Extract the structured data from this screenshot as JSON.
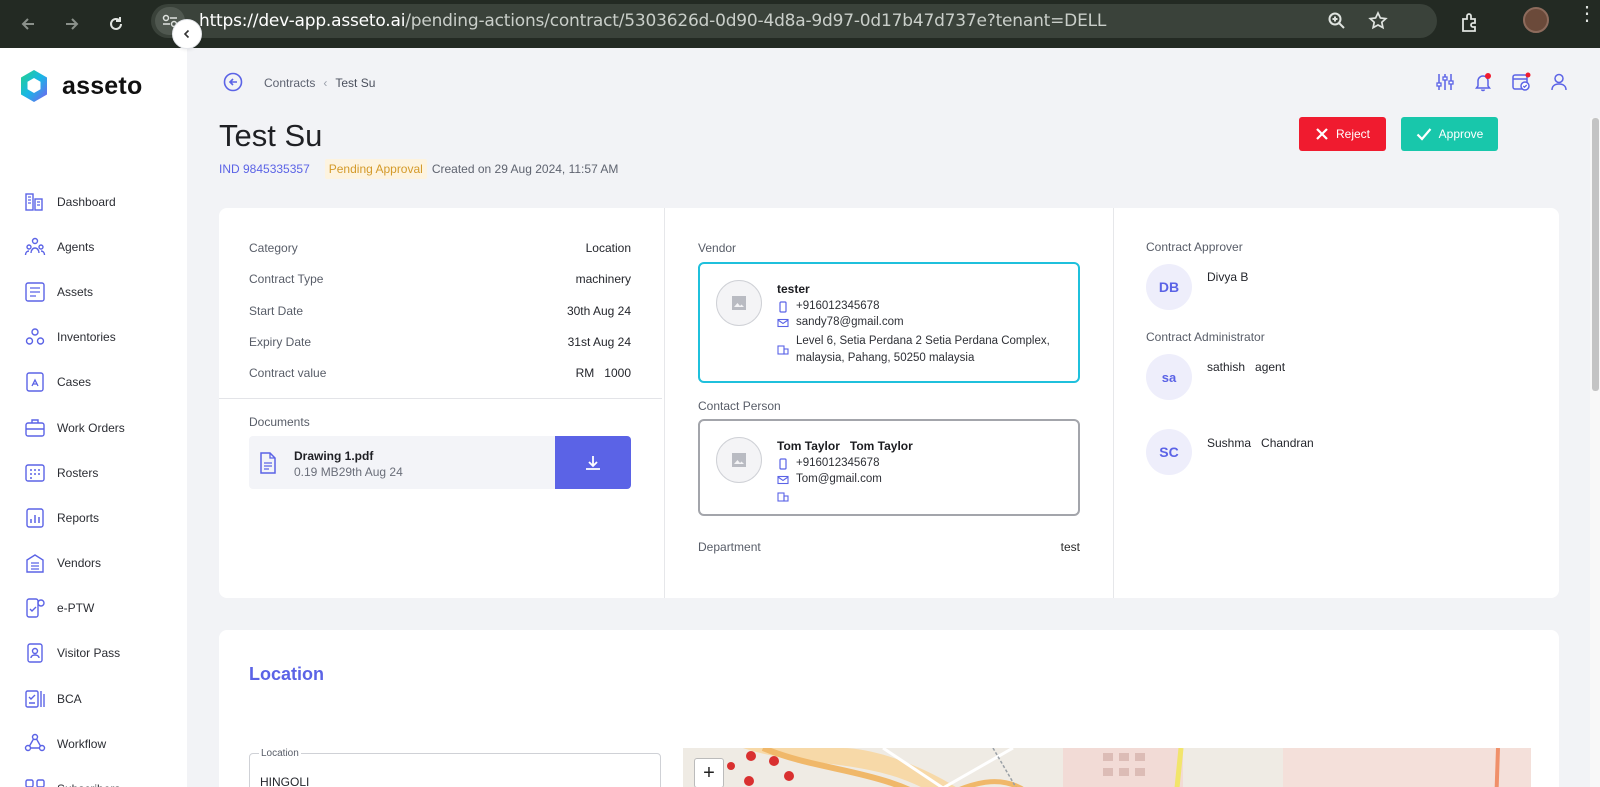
{
  "browser": {
    "url_host": "https://dev-app.asseto.ai",
    "url_path": "/pending-actions/contract/5303626d-0d90-4d8a-9d97-0d17b47d737e?tenant=DELL"
  },
  "app": {
    "brand": "asseto"
  },
  "sidebar": {
    "items": [
      {
        "label": "Dashboard",
        "icon": "dashboard-icon"
      },
      {
        "label": "Agents",
        "icon": "agents-icon"
      },
      {
        "label": "Assets",
        "icon": "assets-icon"
      },
      {
        "label": "Inventories",
        "icon": "inventories-icon"
      },
      {
        "label": "Cases",
        "icon": "cases-icon"
      },
      {
        "label": "Work Orders",
        "icon": "work-orders-icon"
      },
      {
        "label": "Rosters",
        "icon": "rosters-icon"
      },
      {
        "label": "Reports",
        "icon": "reports-icon"
      },
      {
        "label": "Vendors",
        "icon": "vendors-icon"
      },
      {
        "label": "e-PTW",
        "icon": "eptw-icon"
      },
      {
        "label": "Visitor Pass",
        "icon": "visitor-pass-icon"
      },
      {
        "label": "BCA",
        "icon": "bca-icon"
      },
      {
        "label": "Workflow",
        "icon": "workflow-icon"
      },
      {
        "label": "Subscribers",
        "icon": "subscribers-icon"
      }
    ]
  },
  "breadcrumb": {
    "parent": "Contracts",
    "current": "Test Su"
  },
  "header": {
    "title": "Test Su",
    "ind": "IND 9845335357",
    "status": "Pending Approval",
    "created": "Created on 29 Aug 2024, 11:57 AM",
    "reject_label": "Reject",
    "approve_label": "Approve"
  },
  "details": {
    "rows": [
      {
        "key": "Category",
        "value": "Location"
      },
      {
        "key": "Contract Type",
        "value": "machinery"
      },
      {
        "key": "Start Date",
        "value": "30th Aug 24"
      },
      {
        "key": "Expiry Date",
        "value": "31st Aug 24"
      },
      {
        "key": "Contract value",
        "value": "RM   1000"
      }
    ],
    "documents_label": "Documents",
    "document": {
      "name": "Drawing 1.pdf",
      "meta": "0.19 MB29th Aug 24"
    }
  },
  "vendor": {
    "label": "Vendor",
    "name": "tester",
    "phone": "+916012345678",
    "email": "sandy78@gmail.com",
    "address_line1": "Level 6, Setia Perdana 2 Setia Perdana Complex,",
    "address_line2": "malaysia, Pahang, 50250 malaysia"
  },
  "contact": {
    "label": "Contact Person",
    "name": "Tom Taylor   Tom Taylor",
    "phone": "+916012345678",
    "email": "Tom@gmail.com",
    "address": ""
  },
  "department": {
    "label": "Department",
    "value": "test"
  },
  "approvers": {
    "approver_label": "Contract Approver",
    "approver": {
      "initials": "DB",
      "name": "Divya B"
    },
    "admin_label": "Contract Administrator",
    "admins": [
      {
        "initials": "sa",
        "name": "sathish   agent"
      },
      {
        "initials": "SC",
        "name": "Sushma   Chandran"
      }
    ]
  },
  "location": {
    "title": "Location",
    "field_label": "Location",
    "field_value": "HINGOLI",
    "zoom_in": "+"
  },
  "colors": {
    "accent": "#5b63e6",
    "reject": "#f01b2f",
    "approve": "#18c7ab",
    "vendor_border": "#1fc0dc",
    "pending_bg": "#fdf3df"
  }
}
